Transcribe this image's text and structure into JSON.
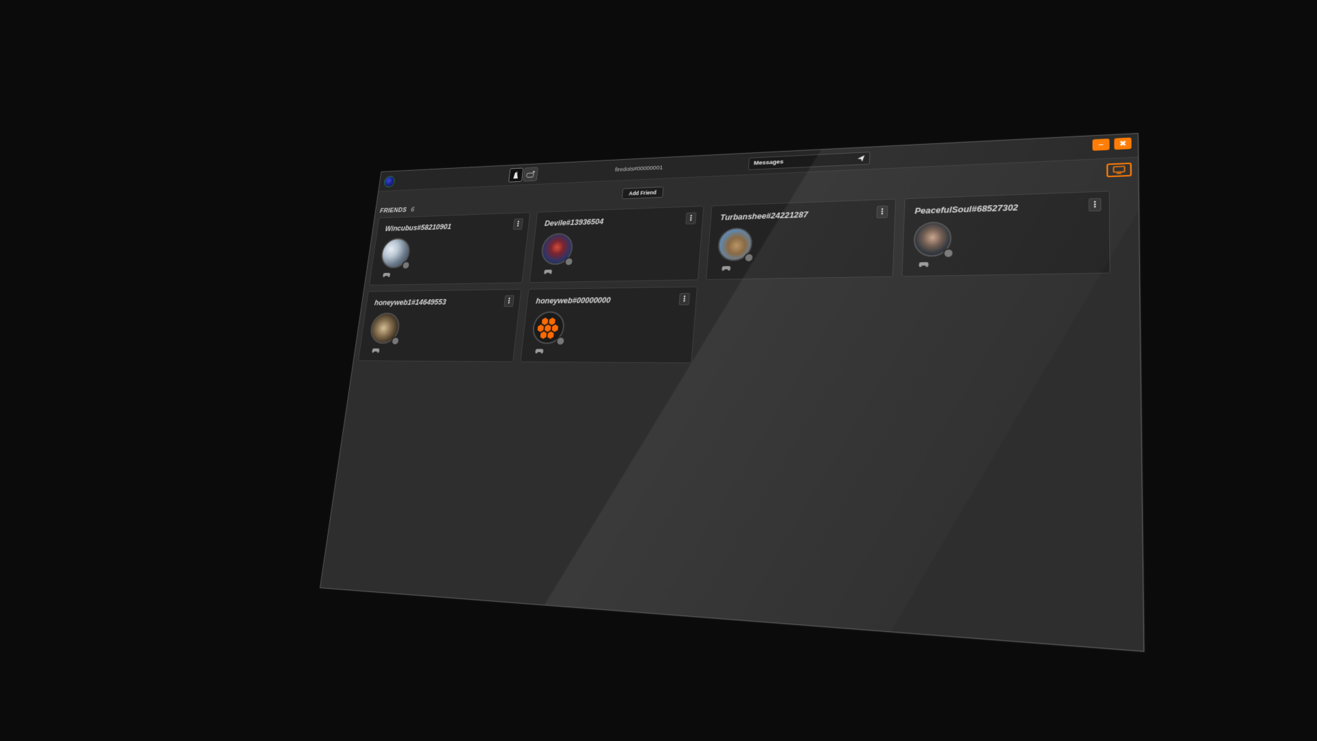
{
  "header": {
    "user_tag": "firedots#00000001",
    "messages_label": "Messages",
    "add_friend_label": "Add Friend",
    "minimize_label": "–",
    "close_label": "✖"
  },
  "friends": {
    "heading": "FRIENDS",
    "count": "6",
    "list": [
      {
        "name": "Wincubus#58210901",
        "status": "offline"
      },
      {
        "name": "Devile#13936504",
        "status": "offline"
      },
      {
        "name": "Turbanshee#24221287",
        "status": "offline"
      },
      {
        "name": "PeacefulSoul#68527302",
        "status": "offline"
      },
      {
        "name": "honeyweb1#14649553",
        "status": "offline"
      },
      {
        "name": "honeyweb#00000000",
        "status": "offline"
      }
    ]
  },
  "colors": {
    "accent": "#ff7a00",
    "panel_bg": "#2e2e2e",
    "card_bg": "#232323",
    "status_offline": "#777777"
  },
  "icons": {
    "logo": "app-logo-icon",
    "profile": "profile-icon",
    "add_game": "add-game-icon",
    "send": "send-icon",
    "screen": "screen-icon",
    "menu": "kebab-menu-icon",
    "game": "gamepad-icon"
  }
}
